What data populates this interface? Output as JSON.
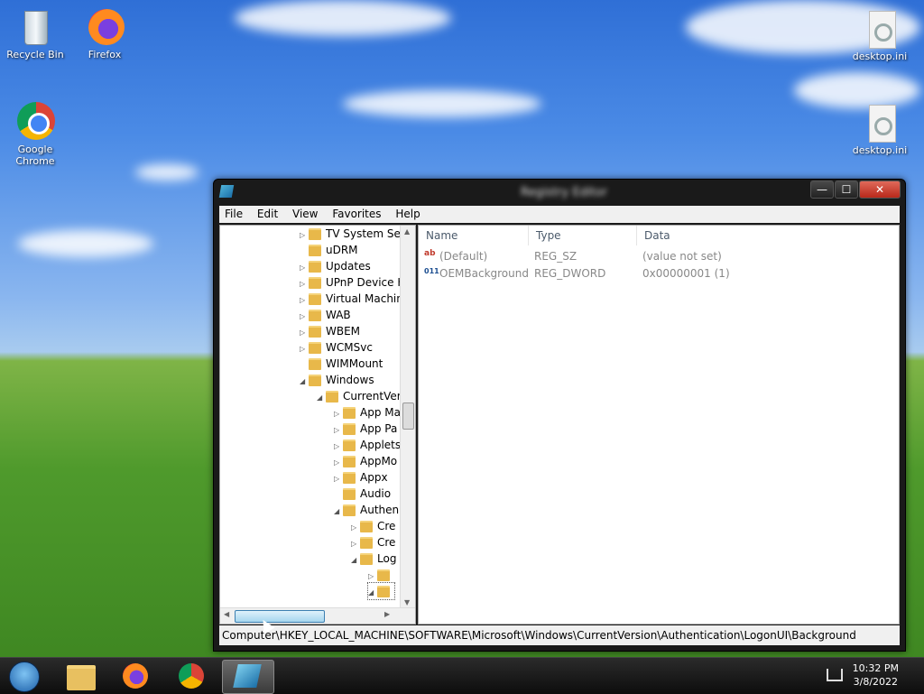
{
  "desktop": {
    "icons": [
      {
        "label": "Recycle Bin"
      },
      {
        "label": "Firefox"
      },
      {
        "label": "Google Chrome"
      },
      {
        "label": "desktop.ini"
      },
      {
        "label": "desktop.ini"
      }
    ]
  },
  "window": {
    "title": "Registry Editor",
    "controls": {
      "minimize": "—",
      "maximize": "☐",
      "close": "✕"
    }
  },
  "menu": [
    "File",
    "Edit",
    "View",
    "Favorites",
    "Help"
  ],
  "tree": [
    {
      "label": "TV System Ser",
      "arrow": "▷"
    },
    {
      "label": "uDRM",
      "arrow": ""
    },
    {
      "label": "Updates",
      "arrow": "▷"
    },
    {
      "label": "UPnP Device H",
      "arrow": "▷"
    },
    {
      "label": "Virtual Machin",
      "arrow": "▷"
    },
    {
      "label": "WAB",
      "arrow": "▷"
    },
    {
      "label": "WBEM",
      "arrow": "▷"
    },
    {
      "label": "WCMSvc",
      "arrow": "▷"
    },
    {
      "label": "WIMMount",
      "arrow": ""
    },
    {
      "label": "Windows",
      "arrow": "◢"
    },
    {
      "label": "CurrentVer",
      "arrow": "◢"
    },
    {
      "label": "App Ma",
      "arrow": "▷"
    },
    {
      "label": "App Pa",
      "arrow": "▷"
    },
    {
      "label": "Applets",
      "arrow": "▷"
    },
    {
      "label": "AppMo",
      "arrow": "▷"
    },
    {
      "label": "Appx",
      "arrow": "▷"
    },
    {
      "label": "Audio",
      "arrow": ""
    },
    {
      "label": "Authen",
      "arrow": "◢"
    },
    {
      "label": "Cre",
      "arrow": "▷"
    },
    {
      "label": "Cre",
      "arrow": "▷"
    },
    {
      "label": "Log",
      "arrow": "◢"
    },
    {
      "label": "",
      "arrow": "▷"
    },
    {
      "label": "",
      "arrow": "◢"
    }
  ],
  "columns": {
    "name": "Name",
    "type": "Type",
    "data": "Data"
  },
  "values": [
    {
      "icon": "ab",
      "name": "(Default)",
      "type": "REG_SZ",
      "data": "(value not set)"
    },
    {
      "icon": "011",
      "name": "OEMBackground",
      "type": "REG_DWORD",
      "data": "0x00000001 (1)"
    }
  ],
  "status": "Computer\\HKEY_LOCAL_MACHINE\\SOFTWARE\\Microsoft\\Windows\\CurrentVersion\\Authentication\\LogonUI\\Background",
  "clock": {
    "time": "10:32 PM",
    "date": "3/8/2022"
  }
}
